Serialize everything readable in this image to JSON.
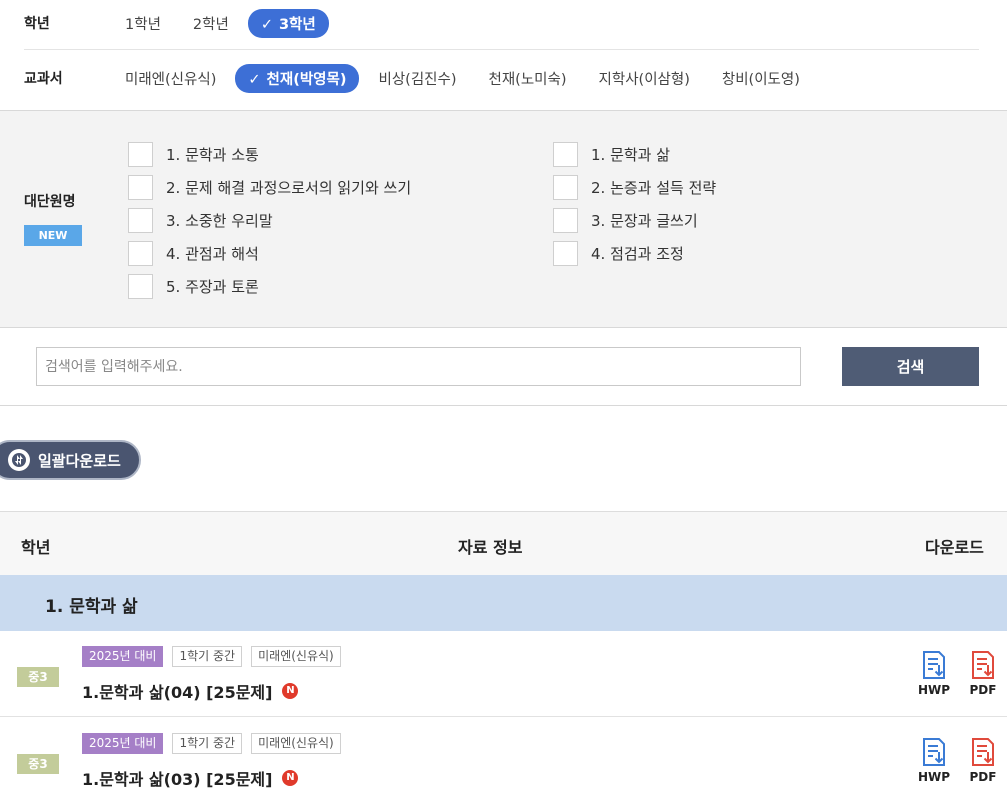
{
  "grade_filter": {
    "label": "학년",
    "options": [
      "1학년",
      "2학년",
      "3학년"
    ],
    "selected": "3학년",
    "check_glyph": "✓"
  },
  "textbook_filter": {
    "label": "교과서",
    "options": [
      "미래엔(신유식)",
      "천재(박영목)",
      "비상(김진수)",
      "천재(노미숙)",
      "지학사(이삼형)",
      "창비(이도영)"
    ],
    "selected": "천재(박영목)"
  },
  "unit_filter": {
    "label": "대단원명",
    "new_badge": "NEW",
    "column1": [
      "1. 문학과 소통",
      "2. 문제 해결 과정으로서의 읽기와 쓰기",
      "3. 소중한 우리말",
      "4. 관점과 해석",
      "5. 주장과 토론"
    ],
    "column2": [
      "1. 문학과 삶",
      "2. 논증과 설득 전략",
      "3. 문장과 글쓰기",
      "4. 점검과 조정"
    ]
  },
  "search": {
    "placeholder": "검색어를 입력해주세요.",
    "button_label": "검색"
  },
  "bulk_download": {
    "label": "일괄다운로드",
    "icon": "download-circle-icon"
  },
  "table": {
    "headers": {
      "grade": "학년",
      "info": "자료 정보",
      "download": "다운로드"
    },
    "section_title": "1. 문학과 삶",
    "items": [
      {
        "grade": "중3",
        "tags": [
          "2025년 대비",
          "1학기 중간",
          "미래엔(신유식)"
        ],
        "title": "1.문학과 삶(04) [25문제]",
        "new_mark": "N",
        "hwp_label": "HWP",
        "pdf_label": "PDF"
      },
      {
        "grade": "중3",
        "tags": [
          "2025년 대비",
          "1학기 중간",
          "미래엔(신유식)"
        ],
        "title": "1.문학과 삶(03) [25문제]",
        "new_mark": "N",
        "hwp_label": "HWP",
        "pdf_label": "PDF"
      }
    ]
  },
  "colors": {
    "selected_chip": "#3d6fd6",
    "search_button": "#4f5c75",
    "section_row": "#c9daef",
    "new_badge": "#5aa7e8",
    "grade_badge": "#c3cc9a",
    "year_tag": "#a57fc7",
    "hwp_icon": "#3a7bd5",
    "pdf_icon": "#e04a3c",
    "n_badge": "#e03a2b"
  }
}
